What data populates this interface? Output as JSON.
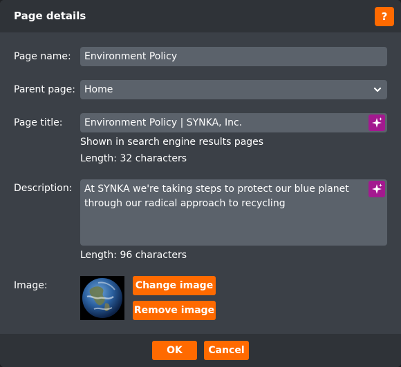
{
  "dialog": {
    "title": "Page details",
    "help_label": "?"
  },
  "form": {
    "page_name_label": "Page name:",
    "page_name_value": "Environment Policy",
    "parent_page_label": "Parent page:",
    "parent_page_value": "Home",
    "page_title_label": "Page title:",
    "page_title_value": "Environment Policy | SYNKA, Inc.",
    "page_title_hint": "Shown in search engine results pages",
    "page_title_length": "Length: 32 characters",
    "description_label": "Description:",
    "description_value": "At SYNKA we're taking steps to protect our blue planet through our radical approach to recycling",
    "description_length": "Length: 96 characters",
    "image_label": "Image:",
    "change_image_label": "Change image",
    "remove_image_label": "Remove image"
  },
  "footer": {
    "ok_label": "OK",
    "cancel_label": "Cancel"
  },
  "colors": {
    "accent": "#ff6a00",
    "ai_button": "#a3198f",
    "field_bg": "#5b626b",
    "dialog_bg": "#3b4047",
    "bar_bg": "#2f3338"
  },
  "icons": {
    "help": "question-mark",
    "dropdown": "chevron-down-icon",
    "ai_generate": "sparkle-icon"
  }
}
